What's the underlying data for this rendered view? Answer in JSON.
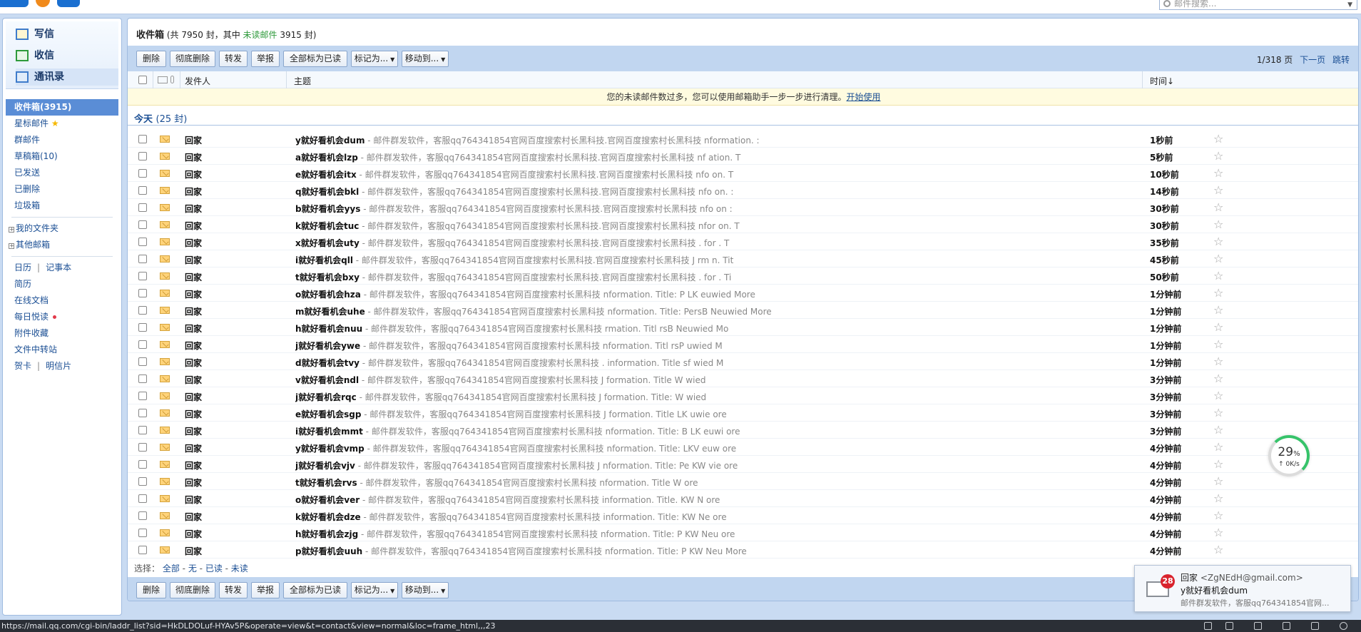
{
  "top": {
    "search_placeholder": "邮件搜索..."
  },
  "left": {
    "compose_label": "写信",
    "receive_label": "收信",
    "contacts_label": "通讯录",
    "folders": {
      "inbox": "收件箱(3915)",
      "starred": "星标邮件",
      "group_mail": "群邮件",
      "drafts": "草稿箱(10)",
      "sent": "已发送",
      "deleted": "已删除",
      "spam": "垃圾箱"
    },
    "my_folders": "我的文件夹",
    "other_mailboxes": "其他邮箱",
    "tools": {
      "calendar": "日历",
      "notes": "记事本",
      "resume": "简历",
      "online_docs": "在线文档",
      "daily_reading": "每日悦读",
      "attachments": "附件收藏",
      "file_transfer": "文件中转站",
      "cards": "贺卡",
      "postcards": "明信片"
    }
  },
  "main": {
    "title": "收件箱",
    "count_text": "(共 7950 封，其中",
    "unread_label": "未读邮件",
    "unread_count_text": "3915 封)",
    "toolbar": {
      "delete": "删除",
      "delete_forever": "彻底删除",
      "forward": "转发",
      "report": "举报",
      "mark_all_read": "全部标为已读",
      "mark_as": "标记为...",
      "move_to": "移动到..."
    },
    "pager": {
      "page": "1/318 页",
      "next": "下一页",
      "jump": "跳转"
    },
    "columns": {
      "sender": "发件人",
      "subject": "主题",
      "time": "时间↓"
    },
    "notice_text": "您的未读邮件数过多，您可以使用邮箱助手一步一步进行清理。",
    "notice_link": "开始使用",
    "group_today": "今天",
    "group_count": "(25 封)",
    "select": {
      "label": "选择：",
      "all": "全部",
      "none": "无",
      "read": "已读",
      "unread": "未读"
    },
    "rows": [
      {
        "sender": "回家",
        "subject": "y就好看机会dum",
        "summary": " - 邮件群发软件，客服qq764341854官网百度搜索村长黑科技.官网百度搜索村长黑科技  nformation. :",
        "time": "1秒前"
      },
      {
        "sender": "回家",
        "subject": "a就好看机会lzp",
        "summary": " - 邮件群发软件，客服qq764341854官网百度搜索村长黑科技.官网百度搜索村长黑科技  nf  ation. T",
        "time": "5秒前"
      },
      {
        "sender": "回家",
        "subject": "e就好看机会itx",
        "summary": " - 邮件群发软件，客服qq764341854官网百度搜索村长黑科技.官网百度搜索村长黑科技  nfo  on. T",
        "time": "10秒前"
      },
      {
        "sender": "回家",
        "subject": "q就好看机会bkl",
        "summary": " - 邮件群发软件，客服qq764341854官网百度搜索村长黑科技.官网百度搜索村长黑科技  nfo  on. :",
        "time": "14秒前"
      },
      {
        "sender": "回家",
        "subject": "b就好看机会yys",
        "summary": " - 邮件群发软件，客服qq764341854官网百度搜索村长黑科技.官网百度搜索村长黑科技  nfo  on  :",
        "time": "30秒前"
      },
      {
        "sender": "回家",
        "subject": "k就好看机会tuc",
        "summary": " - 邮件群发软件，客服qq764341854官网百度搜索村长黑科技.官网百度搜索村长黑科技  nfor  on. T",
        "time": "30秒前"
      },
      {
        "sender": "回家",
        "subject": "x就好看机会uty",
        "summary": " - 邮件群发软件，客服qq764341854官网百度搜索村长黑科技.官网百度搜索村长黑科技 .  for  . T",
        "time": "35秒前"
      },
      {
        "sender": "回家",
        "subject": "i就好看机会qll",
        "summary": " - 邮件群发软件，客服qq764341854官网百度搜索村长黑科技.官网百度搜索村长黑科技 J  rm  n. Tit",
        "time": "45秒前"
      },
      {
        "sender": "回家",
        "subject": "t就好看机会bxy",
        "summary": " - 邮件群发软件，客服qq764341854官网百度搜索村长黑科技.官网百度搜索村长黑科技 .  for  . Ti",
        "time": "50秒前"
      },
      {
        "sender": "回家",
        "subject": "o就好看机会hza",
        "summary": " - 邮件群发软件，客服qq764341854官网百度搜索村长黑科技  nformation. Title: P  LK  euwied More",
        "time": "1分钟前"
      },
      {
        "sender": "回家",
        "subject": "m就好看机会uhe",
        "summary": " - 邮件群发软件，客服qq764341854官网百度搜索村长黑科技   nformation. Title: PersB  Neuwied More",
        "time": "1分钟前"
      },
      {
        "sender": "回家",
        "subject": "h就好看机会nuu",
        "summary": " - 邮件群发软件，客服qq764341854官网百度搜索村长黑科技   rmation. Titl  rsB  Neuwied Mo",
        "time": "1分钟前"
      },
      {
        "sender": "回家",
        "subject": "j就好看机会ywe",
        "summary": " - 邮件群发软件，客服qq764341854官网百度搜索村长黑科技   nformation. Titl  rsP  uwied M",
        "time": "1分钟前"
      },
      {
        "sender": "回家",
        "subject": "d就好看机会tvy",
        "summary": " - 邮件群发软件，客服qq764341854官网百度搜索村长黑科技 .  information. Title  sf  wied M",
        "time": "1分钟前"
      },
      {
        "sender": "回家",
        "subject": "v就好看机会ndl",
        "summary": " - 邮件群发软件，客服qq764341854官网百度搜索村长黑科技 J  formation. Title  W  wied",
        "time": "3分钟前"
      },
      {
        "sender": "回家",
        "subject": "j就好看机会rqc",
        "summary": " - 邮件群发软件，客服qq764341854官网百度搜索村长黑科技 J  formation. Title:  W  wied",
        "time": "3分钟前"
      },
      {
        "sender": "回家",
        "subject": "e就好看机会sgp",
        "summary": " - 邮件群发软件，客服qq764341854官网百度搜索村长黑科技 J  formation. Title  LK  uwie  ore",
        "time": "3分钟前"
      },
      {
        "sender": "回家",
        "subject": "i就好看机会mmt",
        "summary": " - 邮件群发软件，客服qq764341854官网百度搜索村长黑科技   nformation. Title:  B LK  euwi  ore",
        "time": "3分钟前"
      },
      {
        "sender": "回家",
        "subject": "y就好看机会vmp",
        "summary": " - 邮件群发软件，客服qq764341854官网百度搜索村长黑科技   nformation. Title:  LKV  euw  ore",
        "time": "4分钟前"
      },
      {
        "sender": "回家",
        "subject": "j就好看机会vjv",
        "summary": " - 邮件群发软件，客服qq764341854官网百度搜索村长黑科技 J  nformation. Title: Pe  KW  vie  ore",
        "time": "4分钟前"
      },
      {
        "sender": "回家",
        "subject": "t就好看机会rvs",
        "summary": " - 邮件群发软件，客服qq764341854官网百度搜索村长黑科技   nformation. Title  W  ore",
        "time": "4分钟前"
      },
      {
        "sender": "回家",
        "subject": "o就好看机会ver",
        "summary": " - 邮件群发软件，客服qq764341854官网百度搜索村长黑科技   information. Title.  KW N  ore",
        "time": "4分钟前"
      },
      {
        "sender": "回家",
        "subject": "k就好看机会dze",
        "summary": " - 邮件群发软件，客服qq764341854官网百度搜索村长黑科技   information. Title:  KW Ne  ore",
        "time": "4分钟前"
      },
      {
        "sender": "回家",
        "subject": "h就好看机会zjg",
        "summary": " - 邮件群发软件，客服qq764341854官网百度搜索村长黑科技   nformation. Title: P  KW Neu  ore",
        "time": "4分钟前"
      },
      {
        "sender": "回家",
        "subject": "p就好看机会uuh",
        "summary": " - 邮件群发软件，客服qq764341854官网百度搜索村长黑科技   nformation. Title: P  KW Neu  More",
        "time": "4分钟前"
      }
    ]
  },
  "speed_widget": {
    "percent": "29",
    "percent_unit": "%",
    "rate": "↑ 0K/s"
  },
  "notification": {
    "badge": "28",
    "from_name": "回家",
    "from_addr": "<ZgNEdH@gmail.com>",
    "title": "y就好看机会dum",
    "snippet": "邮件群发软件，客服qq764341854官网..."
  },
  "status_bar": {
    "url": "https://mail.qq.com/cgi-bin/laddr_list?sid=HkDLDOLuf-HYAv5P&operate=view&t=contact&view=normal&loc=frame_html,,,23"
  },
  "colors": {
    "accent": "#5a8dd6",
    "link": "#1b4f94",
    "unread_green": "#2e9a3b",
    "notice_bg": "#fffbe0",
    "badge_red": "#d9232d"
  }
}
